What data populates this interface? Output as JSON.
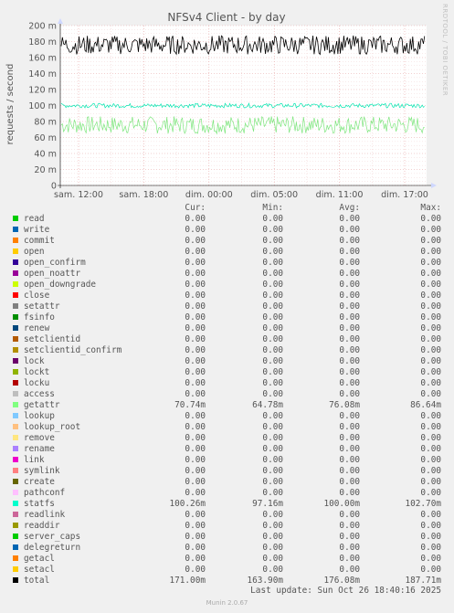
{
  "chart_data": {
    "type": "line",
    "title": "NFSv4 Client - by day",
    "ylabel": "requests / second",
    "ylim": [
      0,
      200
    ],
    "yticks": [
      "0",
      "20 m",
      "40 m",
      "60 m",
      "80 m",
      "100 m",
      "120 m",
      "140 m",
      "160 m",
      "180 m",
      "200 m"
    ],
    "xticks": [
      "sam. 12:00",
      "sam. 18:00",
      "dim. 00:00",
      "dim. 05:00",
      "dim. 11:00",
      "dim. 17:00"
    ],
    "series": [
      {
        "name": "getattr",
        "color": "#7ee67e",
        "band": [
          64.78,
          86.64
        ]
      },
      {
        "name": "statfs",
        "color": "#00e6b0",
        "band": [
          97.16,
          102.7
        ]
      },
      {
        "name": "total",
        "color": "#000000",
        "band": [
          163.9,
          187.71
        ]
      }
    ]
  },
  "side_text": "RRDTOOL / TOBI OETIKER",
  "legend": {
    "headers": [
      "Cur:",
      "Min:",
      "Avg:",
      "Max:"
    ],
    "rows": [
      {
        "name": "read",
        "color": "#00cc00",
        "cur": "0.00",
        "min": "0.00",
        "avg": "0.00",
        "max": "0.00"
      },
      {
        "name": "write",
        "color": "#0066b3",
        "cur": "0.00",
        "min": "0.00",
        "avg": "0.00",
        "max": "0.00"
      },
      {
        "name": "commit",
        "color": "#ff8000",
        "cur": "0.00",
        "min": "0.00",
        "avg": "0.00",
        "max": "0.00"
      },
      {
        "name": "open",
        "color": "#ffcc00",
        "cur": "0.00",
        "min": "0.00",
        "avg": "0.00",
        "max": "0.00"
      },
      {
        "name": "open_confirm",
        "color": "#330099",
        "cur": "0.00",
        "min": "0.00",
        "avg": "0.00",
        "max": "0.00"
      },
      {
        "name": "open_noattr",
        "color": "#990099",
        "cur": "0.00",
        "min": "0.00",
        "avg": "0.00",
        "max": "0.00"
      },
      {
        "name": "open_downgrade",
        "color": "#ccff00",
        "cur": "0.00",
        "min": "0.00",
        "avg": "0.00",
        "max": "0.00"
      },
      {
        "name": "close",
        "color": "#ff0000",
        "cur": "0.00",
        "min": "0.00",
        "avg": "0.00",
        "max": "0.00"
      },
      {
        "name": "setattr",
        "color": "#808080",
        "cur": "0.00",
        "min": "0.00",
        "avg": "0.00",
        "max": "0.00"
      },
      {
        "name": "fsinfo",
        "color": "#008f00",
        "cur": "0.00",
        "min": "0.00",
        "avg": "0.00",
        "max": "0.00"
      },
      {
        "name": "renew",
        "color": "#00487d",
        "cur": "0.00",
        "min": "0.00",
        "avg": "0.00",
        "max": "0.00"
      },
      {
        "name": "setclientid",
        "color": "#b35a00",
        "cur": "0.00",
        "min": "0.00",
        "avg": "0.00",
        "max": "0.00"
      },
      {
        "name": "setclientid_confirm",
        "color": "#b38f00",
        "cur": "0.00",
        "min": "0.00",
        "avg": "0.00",
        "max": "0.00"
      },
      {
        "name": "lock",
        "color": "#6b006b",
        "cur": "0.00",
        "min": "0.00",
        "avg": "0.00",
        "max": "0.00"
      },
      {
        "name": "lockt",
        "color": "#8fb300",
        "cur": "0.00",
        "min": "0.00",
        "avg": "0.00",
        "max": "0.00"
      },
      {
        "name": "locku",
        "color": "#b30000",
        "cur": "0.00",
        "min": "0.00",
        "avg": "0.00",
        "max": "0.00"
      },
      {
        "name": "access",
        "color": "#bebebe",
        "cur": "0.00",
        "min": "0.00",
        "avg": "0.00",
        "max": "0.00"
      },
      {
        "name": "getattr",
        "color": "#80ff80",
        "cur": "70.74m",
        "min": "64.78m",
        "avg": "76.08m",
        "max": "86.64m"
      },
      {
        "name": "lookup",
        "color": "#80c9ff",
        "cur": "0.00",
        "min": "0.00",
        "avg": "0.00",
        "max": "0.00"
      },
      {
        "name": "lookup_root",
        "color": "#ffc080",
        "cur": "0.00",
        "min": "0.00",
        "avg": "0.00",
        "max": "0.00"
      },
      {
        "name": "remove",
        "color": "#ffe680",
        "cur": "0.00",
        "min": "0.00",
        "avg": "0.00",
        "max": "0.00"
      },
      {
        "name": "rename",
        "color": "#aa80ff",
        "cur": "0.00",
        "min": "0.00",
        "avg": "0.00",
        "max": "0.00"
      },
      {
        "name": "link",
        "color": "#ee00cc",
        "cur": "0.00",
        "min": "0.00",
        "avg": "0.00",
        "max": "0.00"
      },
      {
        "name": "symlink",
        "color": "#ff8080",
        "cur": "0.00",
        "min": "0.00",
        "avg": "0.00",
        "max": "0.00"
      },
      {
        "name": "create",
        "color": "#666600",
        "cur": "0.00",
        "min": "0.00",
        "avg": "0.00",
        "max": "0.00"
      },
      {
        "name": "pathconf",
        "color": "#ffbfff",
        "cur": "0.00",
        "min": "0.00",
        "avg": "0.00",
        "max": "0.00"
      },
      {
        "name": "statfs",
        "color": "#00ffcc",
        "cur": "100.26m",
        "min": "97.16m",
        "avg": "100.00m",
        "max": "102.70m"
      },
      {
        "name": "readlink",
        "color": "#cc6699",
        "cur": "0.00",
        "min": "0.00",
        "avg": "0.00",
        "max": "0.00"
      },
      {
        "name": "readdir",
        "color": "#999900",
        "cur": "0.00",
        "min": "0.00",
        "avg": "0.00",
        "max": "0.00"
      },
      {
        "name": "server_caps",
        "color": "#00cc00",
        "cur": "0.00",
        "min": "0.00",
        "avg": "0.00",
        "max": "0.00"
      },
      {
        "name": "delegreturn",
        "color": "#0066b3",
        "cur": "0.00",
        "min": "0.00",
        "avg": "0.00",
        "max": "0.00"
      },
      {
        "name": "getacl",
        "color": "#ff8000",
        "cur": "0.00",
        "min": "0.00",
        "avg": "0.00",
        "max": "0.00"
      },
      {
        "name": "setacl",
        "color": "#ffcc00",
        "cur": "0.00",
        "min": "0.00",
        "avg": "0.00",
        "max": "0.00"
      },
      {
        "name": "total",
        "color": "#000000",
        "cur": "171.00m",
        "min": "163.90m",
        "avg": "176.08m",
        "max": "187.71m"
      }
    ]
  },
  "last_update": "Last update: Sun Oct 26 18:40:16 2025",
  "version": "Munin 2.0.67"
}
